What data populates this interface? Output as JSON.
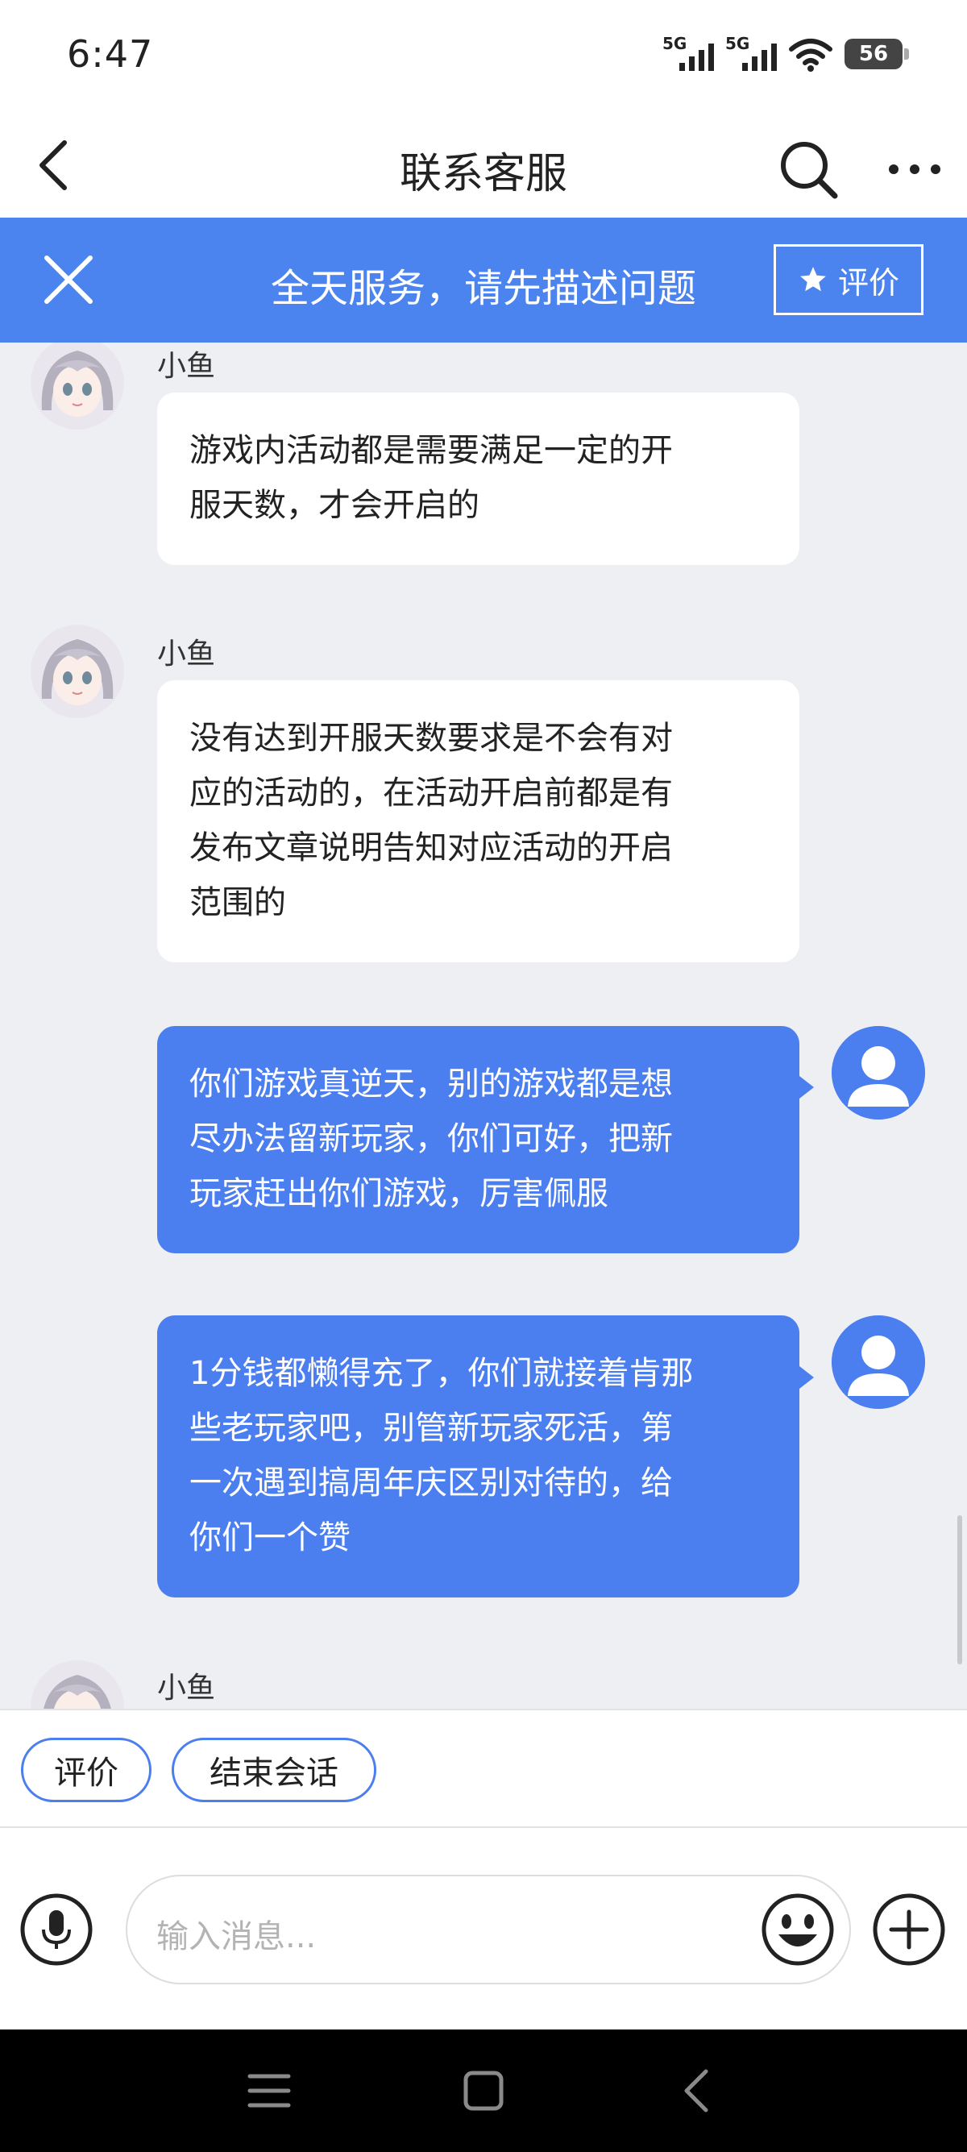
{
  "status_bar": {
    "time": "6:47",
    "network_1": "5G",
    "network_2": "5G",
    "battery_level": "56"
  },
  "header": {
    "title": "联系客服",
    "back_icon": "chevron-left-icon",
    "search_icon": "search-icon",
    "more_icon": "more-horizontal-icon"
  },
  "banner": {
    "text": "全天服务，请先描述问题",
    "rate_label": "评价",
    "color": "#4b84ee"
  },
  "messages": [
    {
      "side": "agent",
      "sender": "小鱼",
      "text": "游戏内活动都是需要满足一定的开\n服天数，才会开启的"
    },
    {
      "side": "agent",
      "sender": "小鱼",
      "text": "没有达到开服天数要求是不会有对\n应的活动的，在活动开启前都是有\n发布文章说明告知对应活动的开启\n范围的"
    },
    {
      "side": "user",
      "text": "你们游戏真逆天，别的游戏都是想\n尽办法留新玩家，你们可好，把新\n玩家赶出你们游戏，厉害佩服"
    },
    {
      "side": "user",
      "text": "1分钱都懒得充了，你们就接着肯那\n些老玩家吧，别管新玩家死活，第\n一次遇到搞周年庆区别对待的，给\n你们一个赞"
    },
    {
      "side": "agent",
      "sender": "小鱼",
      "text": ""
    }
  ],
  "quick_actions": [
    "评价",
    "结束会话"
  ],
  "composer": {
    "placeholder": "输入消息...",
    "mic_icon": "microphone-icon",
    "emoji_icon": "emoji-icon",
    "plus_icon": "plus-icon"
  },
  "nav": {
    "menu_icon": "menu-icon",
    "home_icon": "home-square-icon",
    "back_icon": "back-triangle-icon"
  },
  "colors": {
    "accent": "#4b7eee",
    "chat_background": "#eeeff3",
    "agent_bubble": "#ffffff",
    "user_bubble": "#4b7eee"
  }
}
